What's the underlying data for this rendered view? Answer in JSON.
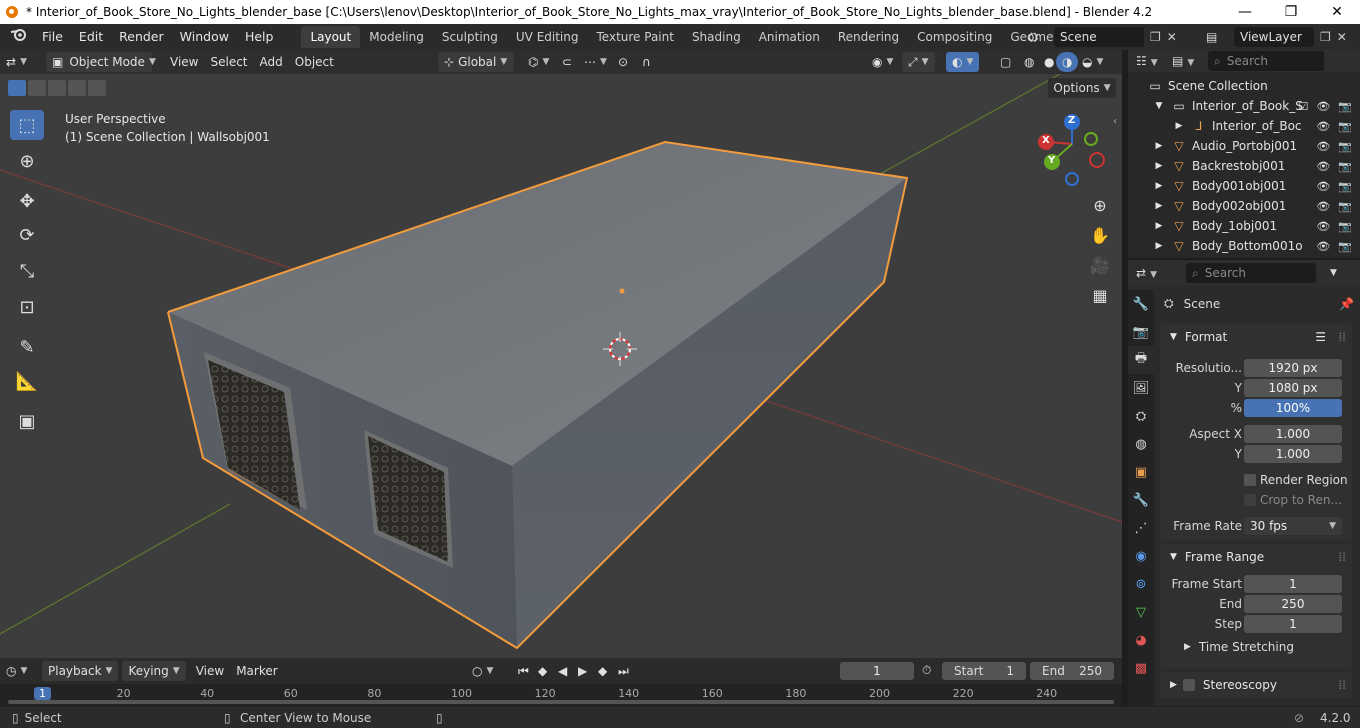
{
  "window": {
    "title": "* Interior_of_Book_Store_No_Lights_blender_base [C:\\Users\\lenov\\Desktop\\Interior_of_Book_Store_No_Lights_max_vray\\Interior_of_Book_Store_No_Lights_blender_base.blend] - Blender 4.2",
    "minimize": "—",
    "restore": "❐",
    "close": "✕"
  },
  "menu": [
    "File",
    "Edit",
    "Render",
    "Window",
    "Help"
  ],
  "workspaces": [
    "Layout",
    "Modeling",
    "Sculpting",
    "UV Editing",
    "Texture Paint",
    "Shading",
    "Animation",
    "Rendering",
    "Compositing",
    "Geometry Nod"
  ],
  "scene_field": "Scene",
  "viewlayer_field": "ViewLayer",
  "viewport_header": {
    "mode": "Object Mode",
    "view": "View",
    "select": "Select",
    "add": "Add",
    "object": "Object",
    "transform": "Global",
    "options": "Options"
  },
  "overlay": {
    "line1": "User Perspective",
    "line2": "(1) Scene Collection | Wallsobj001"
  },
  "gizmo": {
    "x": "X",
    "y": "Y",
    "z": "Z"
  },
  "outliner": {
    "search_placeholder": "Search",
    "root": "Scene Collection",
    "collection": "Interior_of_Book_S",
    "child": "Interior_of_Boc",
    "objects": [
      "Audio_Portobj001",
      "Backrestobj001",
      "Body001obj001",
      "Body002obj001",
      "Body_1obj001",
      "Body_Bottom001o"
    ]
  },
  "properties": {
    "search_placeholder": "Search",
    "context": "Scene",
    "format": {
      "title": "Format",
      "resolution_label": "Resolutio...",
      "resolution_x": "1920 px",
      "y_label": "Y",
      "resolution_y": "1080 px",
      "pct_label": "%",
      "pct": "100%",
      "aspect_label": "Aspect X",
      "aspect_x": "1.000",
      "aspect_y_label": "Y",
      "aspect_y": "1.000",
      "render_region": "Render Region",
      "crop": "Crop to Ren...",
      "frame_rate_label": "Frame Rate",
      "frame_rate": "30 fps"
    },
    "frame_range": {
      "title": "Frame Range",
      "start_label": "Frame Start",
      "start": "1",
      "end_label": "End",
      "end": "250",
      "step_label": "Step",
      "step": "1"
    },
    "time_stretching": "Time Stretching",
    "stereoscopy": "Stereoscopy"
  },
  "timeline": {
    "playback": "Playback",
    "keying": "Keying",
    "view": "View",
    "marker": "Marker",
    "current_frame": "1",
    "start_label": "Start",
    "start": "1",
    "end_label": "End",
    "end": "250",
    "ticks": [
      "1",
      "20",
      "40",
      "60",
      "80",
      "100",
      "120",
      "140",
      "160",
      "180",
      "200",
      "220",
      "240"
    ]
  },
  "status": {
    "select": "Select",
    "center": "Center View to Mouse",
    "version": "4.2.0"
  },
  "colors": {
    "accent": "#4772b3",
    "selection_outline": "#f39c3c",
    "viewport_bg": "#3d3d3d",
    "header_bg": "#2b2b2b"
  }
}
